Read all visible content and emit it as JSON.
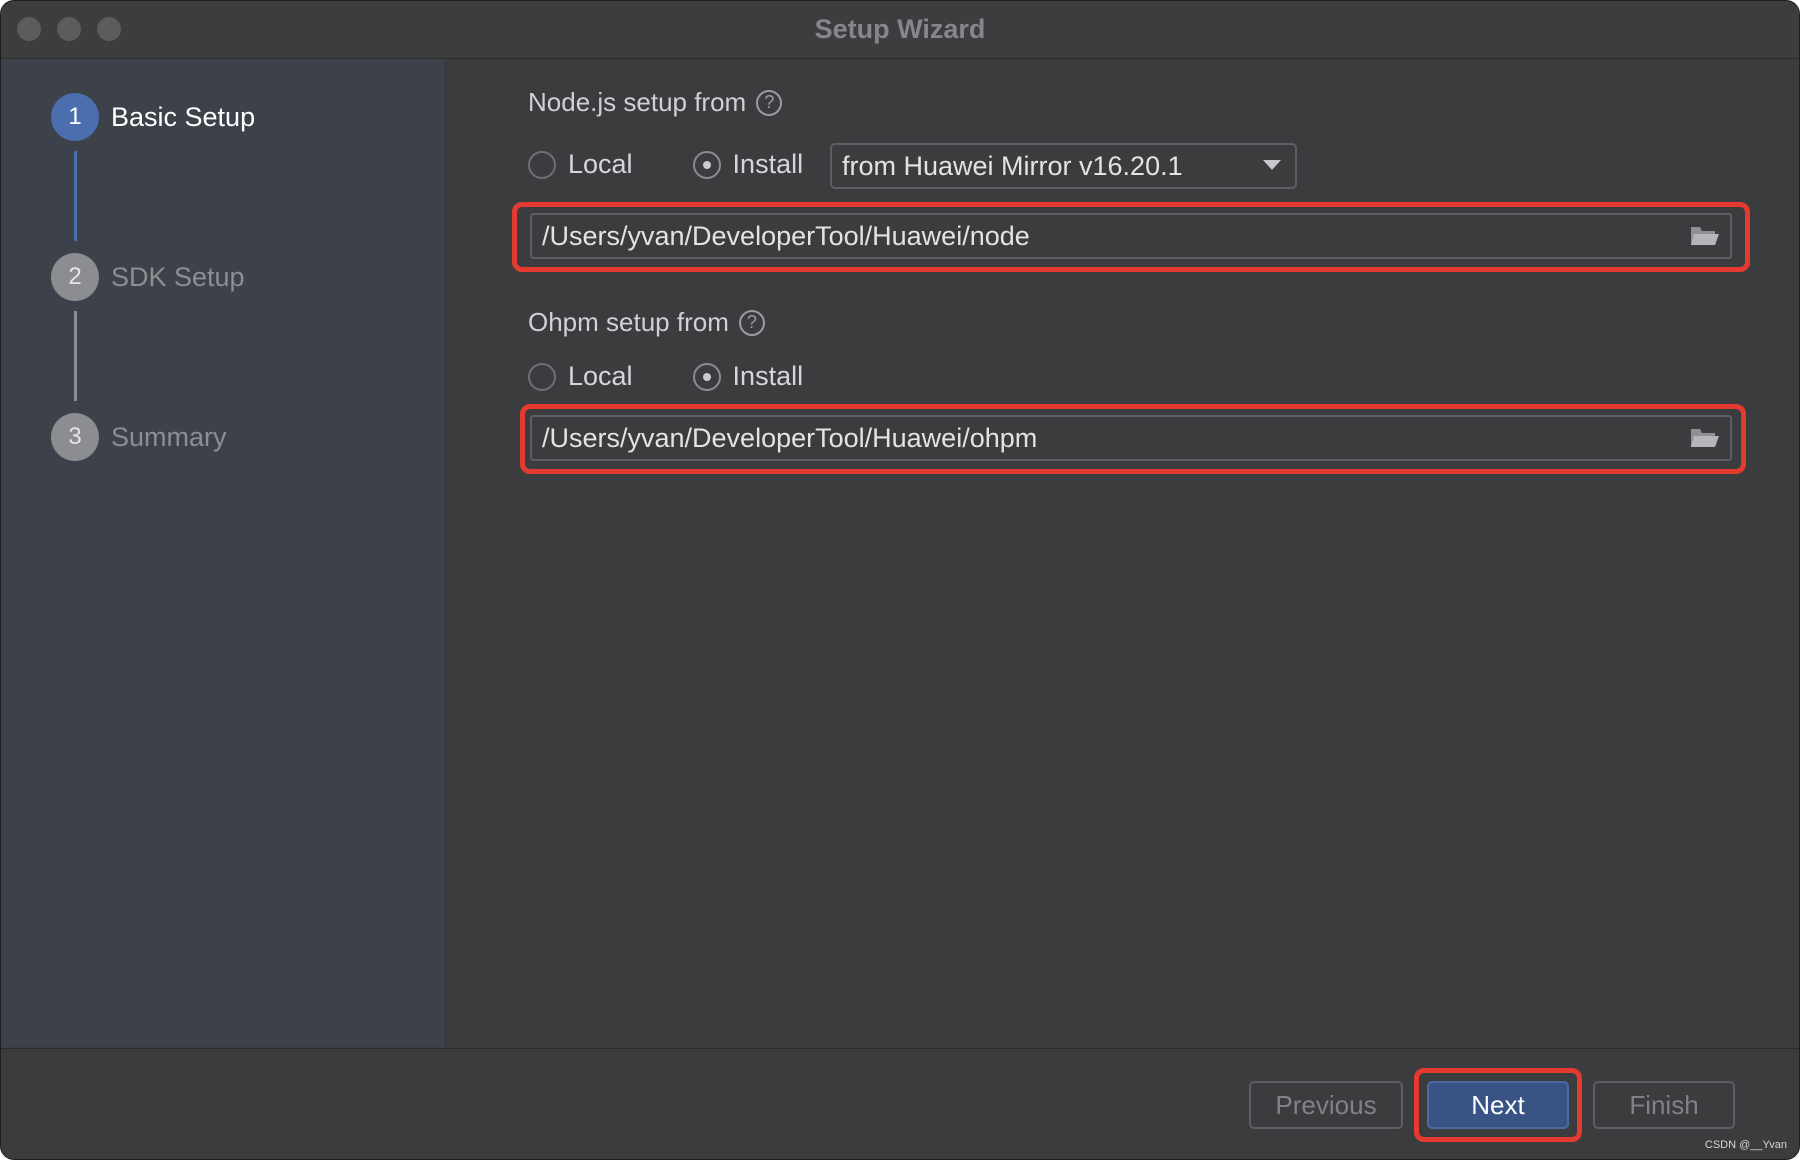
{
  "window": {
    "title": "Setup Wizard"
  },
  "steps": [
    {
      "number": "1",
      "label": "Basic Setup",
      "active": true
    },
    {
      "number": "2",
      "label": "SDK Setup",
      "active": false
    },
    {
      "number": "3",
      "label": "Summary",
      "active": false
    }
  ],
  "node": {
    "section_label": "Node.js setup from",
    "help": "?",
    "option_local": "Local",
    "option_install": "Install",
    "selected": "Install",
    "mirror_select": "from Huawei Mirror v16.20.1",
    "path": "/Users/yvan/DeveloperTool/Huawei/node"
  },
  "ohpm": {
    "section_label": "Ohpm setup from",
    "help": "?",
    "option_local": "Local",
    "option_install": "Install",
    "selected": "Install",
    "path": "/Users/yvan/DeveloperTool/Huawei/ohpm"
  },
  "footer": {
    "previous_label": "Previous",
    "next_label": "Next",
    "finish_label": "Finish"
  },
  "watermark": "CSDN @__Yvan",
  "colors": {
    "accent": "#4b6eaf",
    "highlight": "#e53a2f",
    "background": "#3b3c3e",
    "sidebar": "#3d4149"
  },
  "icons": {
    "folder": "folder-open-icon",
    "help": "help-circle-icon",
    "dropdown": "chevron-down-icon"
  }
}
